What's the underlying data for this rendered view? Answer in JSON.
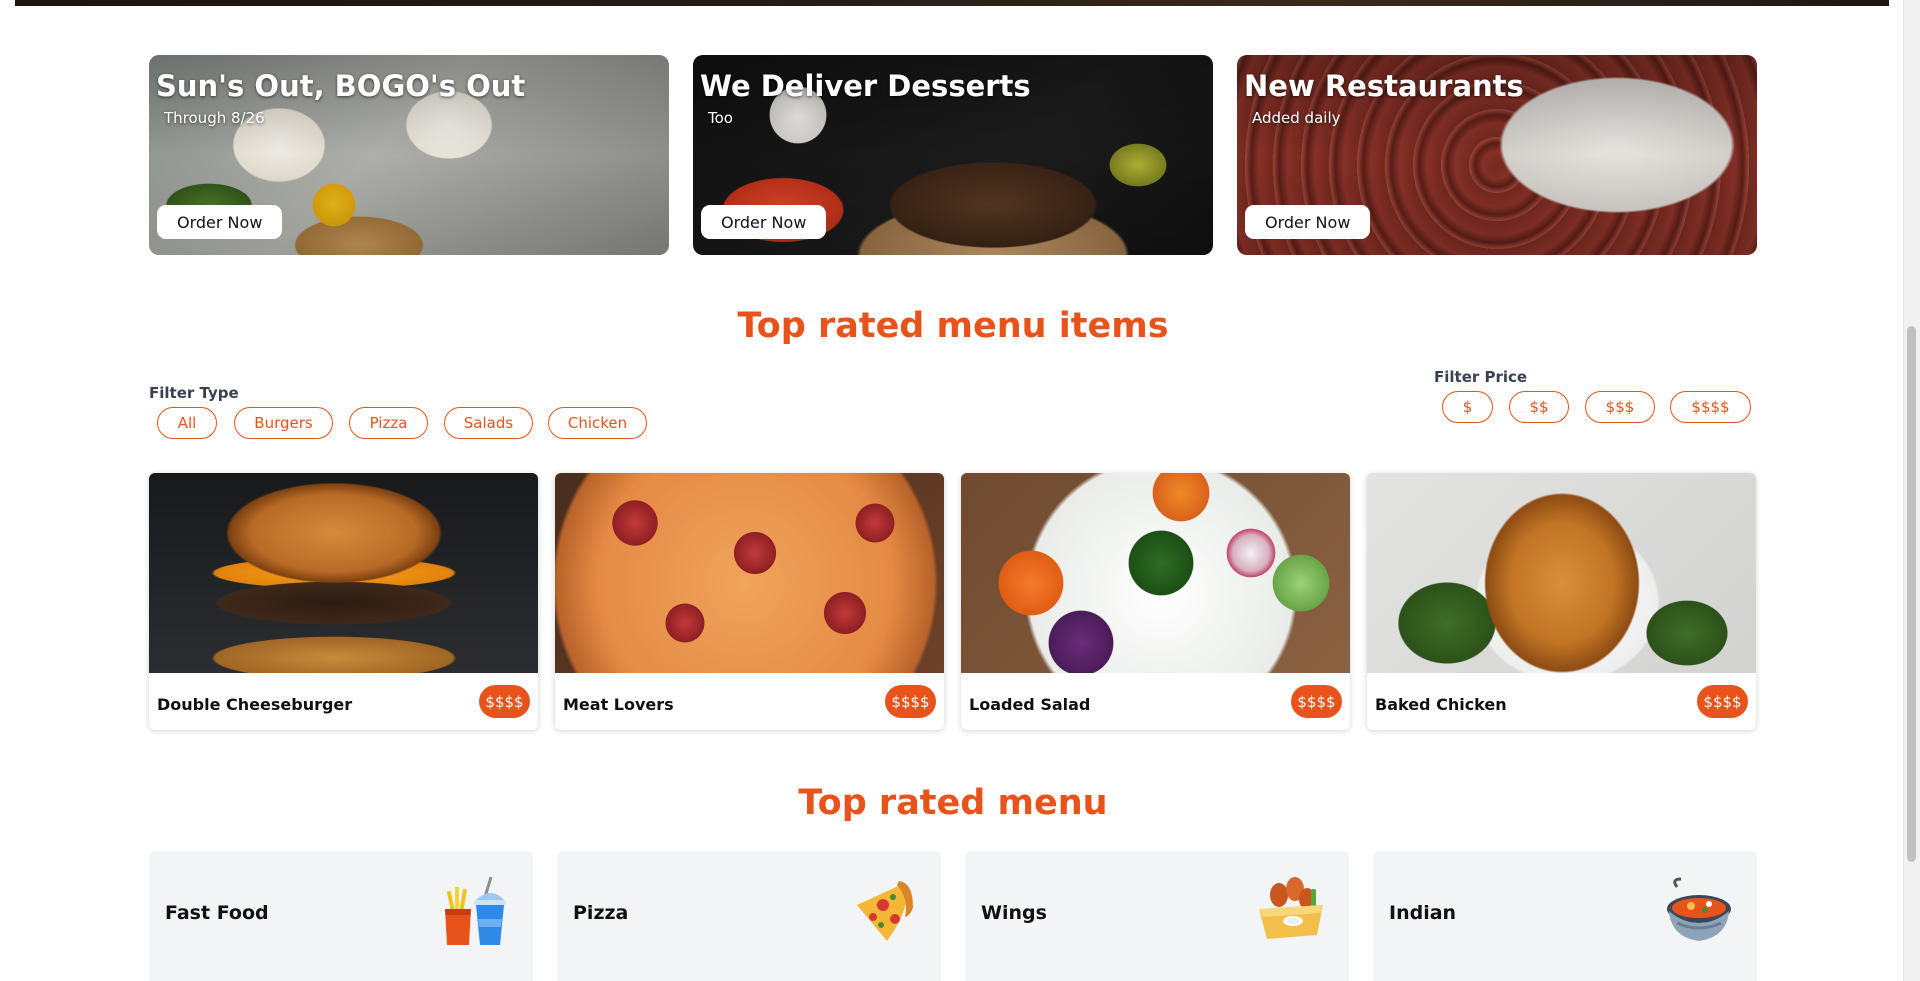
{
  "promos": [
    {
      "title": "Sun's Out, BOGO's Out",
      "subtitle": "Through 8/26",
      "button": "Order Now"
    },
    {
      "title": "We Deliver Desserts",
      "subtitle": "Too",
      "button": "Order Now"
    },
    {
      "title": "New Restaurants",
      "subtitle": "Added daily",
      "button": "Order Now"
    }
  ],
  "menu_items_section": {
    "title": "Top rated menu items",
    "filter_type": {
      "label": "Filter Type",
      "options": [
        "All",
        "Burgers",
        "Pizza",
        "Salads",
        "Chicken"
      ]
    },
    "filter_price": {
      "label": "Filter Price",
      "options": [
        "$",
        "$$",
        "$$$",
        "$$$$"
      ]
    },
    "items": [
      {
        "name": "Double Cheeseburger",
        "price": "$$$$"
      },
      {
        "name": "Meat Lovers",
        "price": "$$$$"
      },
      {
        "name": "Loaded Salad",
        "price": "$$$$"
      },
      {
        "name": "Baked Chicken",
        "price": "$$$$"
      }
    ]
  },
  "menu_section": {
    "title": "Top rated menu",
    "categories": [
      {
        "name": "Fast Food",
        "icon": "fast-food-icon"
      },
      {
        "name": "Pizza",
        "icon": "pizza-slice-icon"
      },
      {
        "name": "Wings",
        "icon": "chicken-wings-icon"
      },
      {
        "name": "Indian",
        "icon": "curry-bowl-icon"
      }
    ]
  },
  "colors": {
    "accent": "#e8531b",
    "category_bg": "#f3f4f6"
  }
}
